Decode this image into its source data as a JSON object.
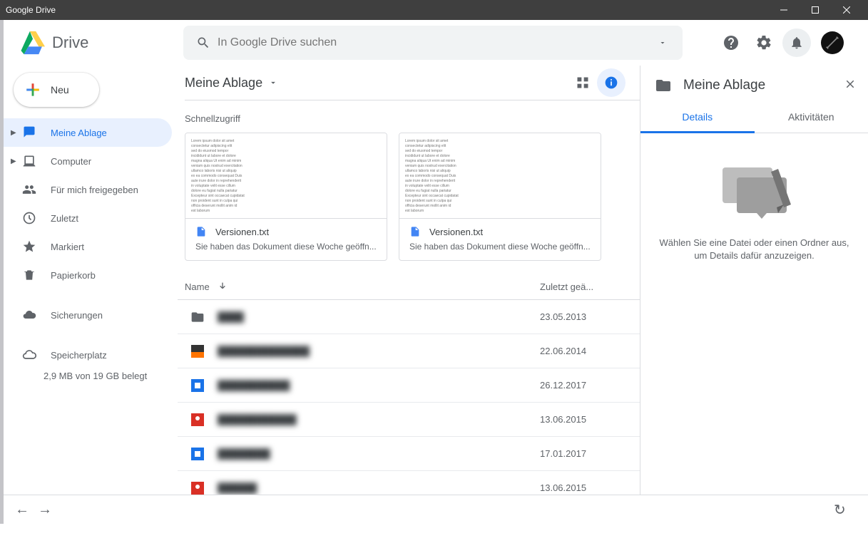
{
  "window": {
    "title": "Google Drive"
  },
  "logo": {
    "text": "Drive"
  },
  "search": {
    "placeholder": "In Google Drive suchen"
  },
  "new_button": {
    "label": "Neu"
  },
  "sidebar": {
    "items": [
      {
        "label": "Meine Ablage",
        "icon": "drive"
      },
      {
        "label": "Computer",
        "icon": "computer"
      },
      {
        "label": "Für mich freigegeben",
        "icon": "shared"
      },
      {
        "label": "Zuletzt",
        "icon": "recent"
      },
      {
        "label": "Markiert",
        "icon": "star"
      },
      {
        "label": "Papierkorb",
        "icon": "trash"
      },
      {
        "label": "Sicherungen",
        "icon": "backup"
      },
      {
        "label": "Speicherplatz",
        "icon": "storage"
      }
    ],
    "storage_text": "2,9 MB von 19 GB belegt"
  },
  "breadcrumb": {
    "label": "Meine Ablage"
  },
  "quick": {
    "heading": "Schnellzugriff",
    "cards": [
      {
        "filename": "Versionen.txt",
        "subtitle": "Sie haben das Dokument diese Woche geöffn..."
      },
      {
        "filename": "Versionen.txt",
        "subtitle": "Sie haben das Dokument diese Woche geöffn..."
      }
    ]
  },
  "columns": {
    "name": "Name",
    "date": "Zuletzt geä..."
  },
  "files": [
    {
      "type": "folder",
      "name": "████",
      "date": "23.05.2013"
    },
    {
      "type": "slides",
      "name": "██████████████",
      "date": "22.06.2014"
    },
    {
      "type": "blue",
      "name": "███████████",
      "date": "26.12.2017"
    },
    {
      "type": "red",
      "name": "████████████",
      "date": "13.06.2015"
    },
    {
      "type": "blue",
      "name": "████████",
      "date": "17.01.2017"
    },
    {
      "type": "red",
      "name": "██████",
      "date": "13.06.2015"
    }
  ],
  "details": {
    "title": "Meine Ablage",
    "tabs": {
      "details": "Details",
      "activity": "Aktivitäten"
    },
    "empty_text": "Wählen Sie eine Datei oder einen Ordner aus, um Details dafür anzuzeigen."
  }
}
